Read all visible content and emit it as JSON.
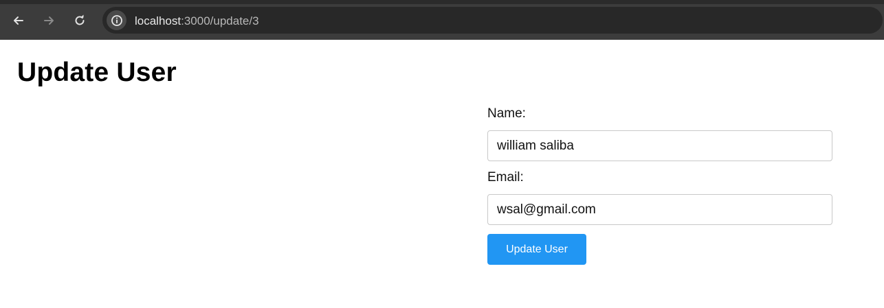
{
  "browser": {
    "url_host": "localhost",
    "url_path": ":3000/update/3",
    "back_icon": "arrow-left-icon",
    "forward_icon": "arrow-right-icon",
    "reload_icon": "reload-icon",
    "info_icon": "info-icon"
  },
  "page": {
    "title": "Update User"
  },
  "form": {
    "name_label": "Name:",
    "name_value": "william saliba",
    "email_label": "Email:",
    "email_value": "wsal@gmail.com",
    "submit_label": "Update User"
  },
  "colors": {
    "accent": "#2196f3",
    "chrome_bg": "#3c3c3c",
    "url_bar_bg": "#282828"
  }
}
